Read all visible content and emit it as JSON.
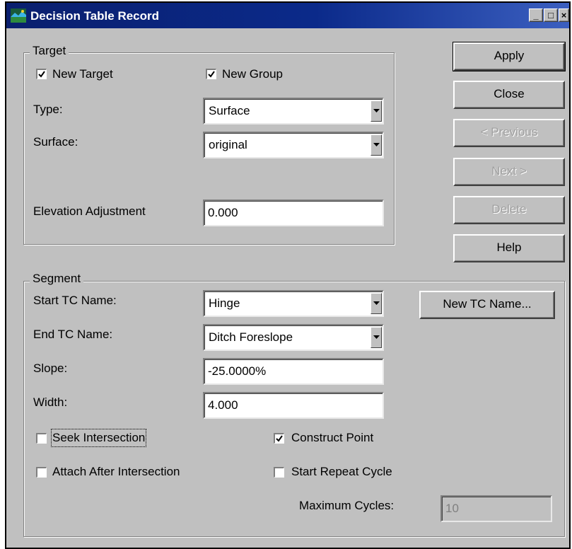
{
  "window": {
    "title": "Decision Table Record",
    "controls": {
      "minimize": "_",
      "maximize": "□",
      "close": "×"
    }
  },
  "target": {
    "group_title": "Target",
    "new_target": {
      "label": "New Target",
      "checked": true
    },
    "new_group": {
      "label": "New Group",
      "checked": true
    },
    "type_label": "Type:",
    "type_value": "Surface",
    "surface_label": "Surface:",
    "surface_value": "original",
    "elevation_label": "Elevation Adjustment",
    "elevation_value": "0.000"
  },
  "buttons": {
    "apply": "Apply",
    "close": "Close",
    "previous": "< Previous",
    "next": "Next >",
    "delete": "Delete",
    "help": "Help",
    "new_tc_name": "New TC Name..."
  },
  "segment": {
    "group_title": "Segment",
    "start_tc_label": "Start TC Name:",
    "start_tc_value": "Hinge",
    "end_tc_label": "End TC Name:",
    "end_tc_value": "Ditch Foreslope",
    "slope_label": "Slope:",
    "slope_value": "-25.0000%",
    "width_label": "Width:",
    "width_value": "4.000",
    "seek_intersection": {
      "label": "Seek Intersection",
      "checked": false
    },
    "construct_point": {
      "label": "Construct Point",
      "checked": true
    },
    "attach_after": {
      "label": "Attach After Intersection",
      "checked": false
    },
    "start_repeat": {
      "label": "Start Repeat Cycle",
      "checked": false
    },
    "max_cycles_label": "Maximum Cycles:",
    "max_cycles_value": "10"
  },
  "icons": {
    "checkmark": "check-icon",
    "dropdown": "chevron-down-icon",
    "app": "app-icon"
  }
}
